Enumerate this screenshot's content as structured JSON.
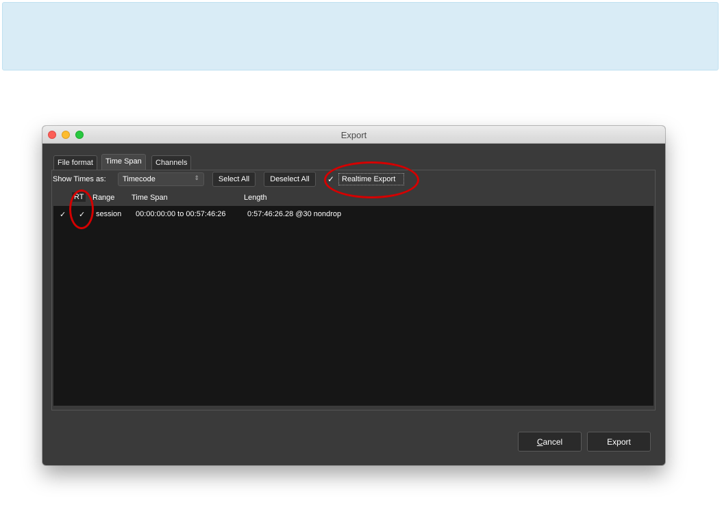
{
  "window": {
    "title": "Export"
  },
  "tabs": [
    {
      "label": "File format"
    },
    {
      "label": "Time Span"
    },
    {
      "label": "Channels"
    }
  ],
  "toolbar": {
    "show_times_label": "Show Times as:",
    "time_format_value": "Timecode",
    "select_all": "Select All",
    "deselect_all": "Deselect All",
    "realtime_export_label": "Realtime Export",
    "realtime_export_checked": true
  },
  "table": {
    "columns": [
      "RT",
      "Range",
      "Time Span",
      "Length"
    ],
    "rows": [
      {
        "selected": true,
        "rt": true,
        "range": "session",
        "time_span": "00:00:00:00 to 00:57:46:26",
        "length": "0:57:46:26.28 @30 nondrop"
      }
    ]
  },
  "footer": {
    "cancel_prefix": "C",
    "cancel_rest": "ancel",
    "export": "Export"
  },
  "colors": {
    "annotation": "#d40000",
    "note_background": "#d9ecf6"
  },
  "icons": {
    "check": "✓",
    "select_arrows": "⇕"
  }
}
